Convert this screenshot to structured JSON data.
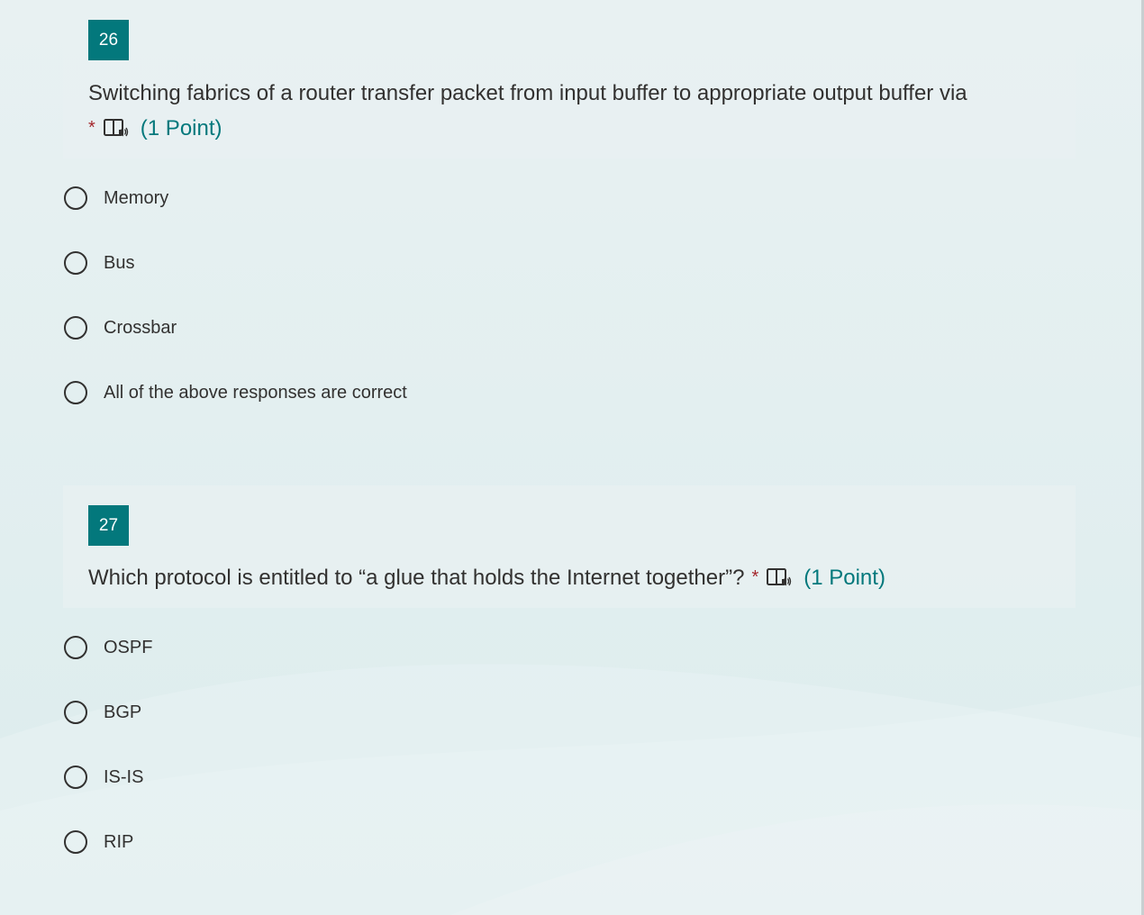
{
  "colors": {
    "accent": "#03787c",
    "required": "#a4262c",
    "text": "#323130"
  },
  "questions": [
    {
      "number": "26",
      "title": "Switching fabrics of a router transfer packet from input buffer to appropriate output buffer via",
      "required_mark": "*",
      "reader_icon": "immersive-reader-icon",
      "points": "(1 Point)",
      "options": [
        "Memory",
        "Bus",
        "Crossbar",
        "All of the above responses are correct"
      ]
    },
    {
      "number": "27",
      "title": "Which protocol is entitled to “a glue that holds the Internet together”?",
      "required_mark": "*",
      "reader_icon": "immersive-reader-icon",
      "points": "(1 Point)",
      "options": [
        "OSPF",
        "BGP",
        "IS-IS",
        "RIP"
      ]
    }
  ]
}
